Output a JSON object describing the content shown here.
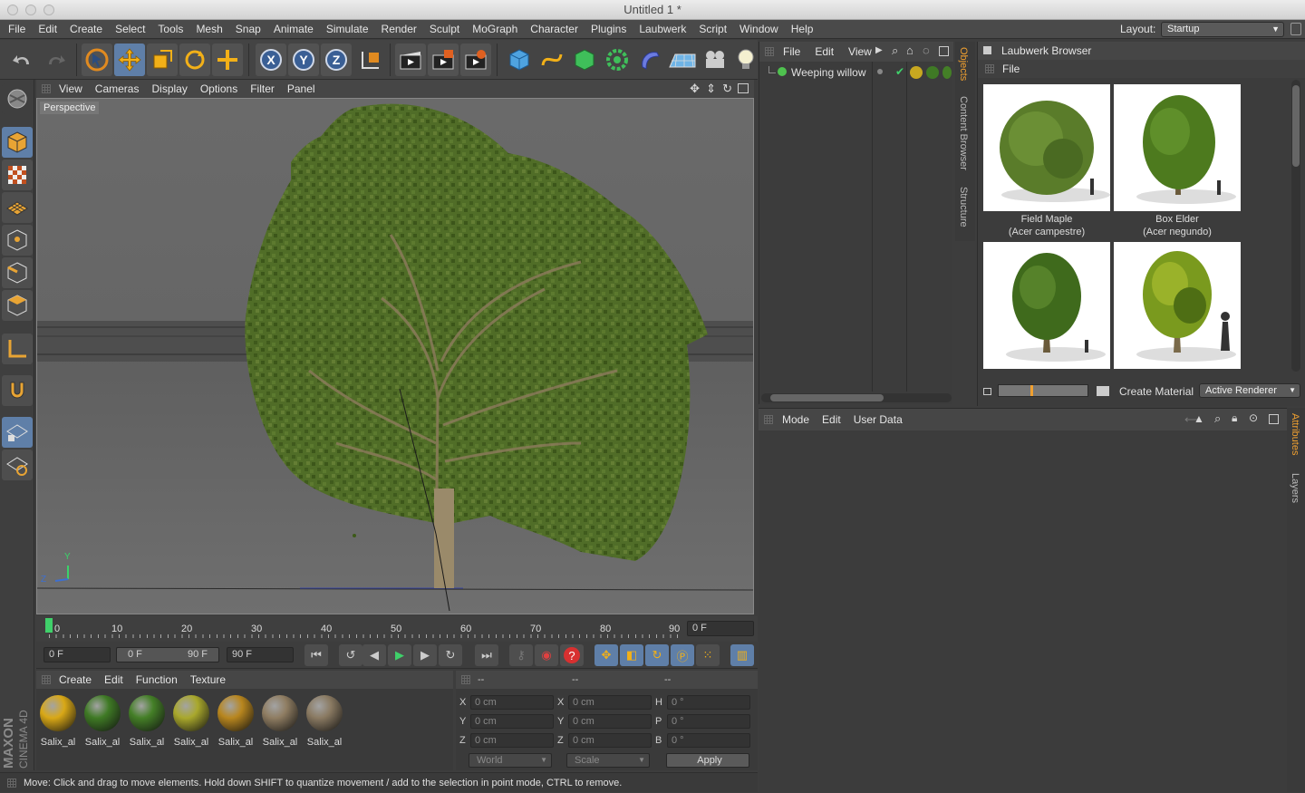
{
  "window": {
    "title": "Untitled 1 *"
  },
  "menubar": {
    "items": [
      "File",
      "Edit",
      "Create",
      "Select",
      "Tools",
      "Mesh",
      "Snap",
      "Animate",
      "Simulate",
      "Render",
      "Sculpt",
      "MoGraph",
      "Character",
      "Plugins",
      "Laubwerk",
      "Script",
      "Window",
      "Help"
    ],
    "layout_label": "Layout:",
    "layout_value": "Startup"
  },
  "viewport": {
    "menu": [
      "View",
      "Cameras",
      "Display",
      "Options",
      "Filter",
      "Panel"
    ],
    "camera_label": "Perspective",
    "axis_y": "Y",
    "axis_z": "Z"
  },
  "timeline": {
    "ticks": [
      "0",
      "10",
      "20",
      "30",
      "40",
      "50",
      "60",
      "70",
      "80",
      "90"
    ],
    "current_frame": "0 F"
  },
  "transport": {
    "start": "0 F",
    "range_start": "0 F",
    "range_end": "90 F",
    "end": "90 F"
  },
  "materials": {
    "menu": [
      "Create",
      "Edit",
      "Function",
      "Texture"
    ],
    "items": [
      {
        "label": "Salix_al",
        "color": "#d9a816"
      },
      {
        "label": "Salix_al",
        "color": "#3f7a25"
      },
      {
        "label": "Salix_al",
        "color": "#447f27"
      },
      {
        "label": "Salix_al",
        "color": "#a9a82c"
      },
      {
        "label": "Salix_al",
        "color": "#b8861e"
      },
      {
        "label": "Salix_al",
        "color": "#8f7d62"
      },
      {
        "label": "Salix_al",
        "color": "#8a7a62"
      }
    ]
  },
  "coordinates": {
    "headers": [
      "--",
      "--",
      "--"
    ],
    "pos": {
      "x": "0 cm",
      "y": "0 cm",
      "z": "0 cm"
    },
    "size": {
      "x": "0 cm",
      "y": "0 cm",
      "z": "0 cm"
    },
    "rot": {
      "h": "0 °",
      "p": "0 °",
      "b": "0 °"
    },
    "mode_select": "World",
    "scale_select": "Scale",
    "apply_label": "Apply",
    "labels": {
      "x": "X",
      "y": "Y",
      "z": "Z",
      "h": "H",
      "p": "P",
      "b": "B"
    }
  },
  "status": {
    "text": "Move: Click and drag to move elements. Hold down SHIFT to quantize movement / add to the selection in point mode, CTRL to remove."
  },
  "objects": {
    "menu": [
      "File",
      "Edit",
      "View"
    ],
    "items": [
      {
        "name": "Weeping willow"
      }
    ]
  },
  "side_tabs": [
    "Objects",
    "Content Browser",
    "Structure"
  ],
  "browser": {
    "title": "Laubwerk Browser",
    "menu_file": "File",
    "thumbs": [
      {
        "line1": "Field Maple",
        "line2": "(Acer campestre)"
      },
      {
        "line1": "Box Elder",
        "line2": "(Acer negundo)"
      },
      {
        "line1": "",
        "line2": ""
      },
      {
        "line1": "",
        "line2": ""
      }
    ],
    "create_material": "Create Material",
    "renderer": "Active Renderer",
    "slider_value": 0.36
  },
  "attributes": {
    "menu": [
      "Mode",
      "Edit",
      "User Data"
    ],
    "tabs": [
      "Attributes",
      "Layers"
    ]
  },
  "brand": {
    "line1": "MAXON",
    "line2": "CINEMA 4D"
  },
  "colors": {
    "accent": "#5f7fa8",
    "highlight": "#f0a030",
    "foliage": "#4d6b22"
  }
}
